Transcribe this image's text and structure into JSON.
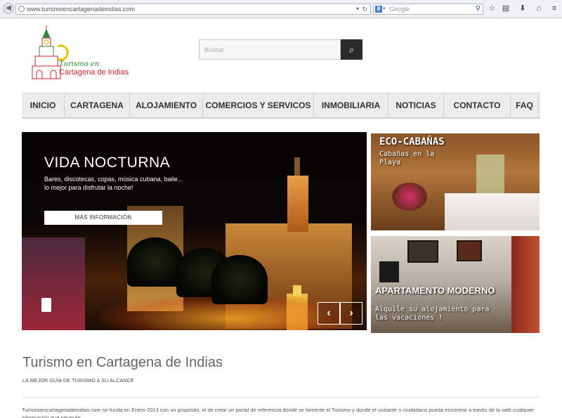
{
  "browser": {
    "url": "www.turismoencartagenadeindias.com",
    "search_placeholder": "Google"
  },
  "logo": {
    "line1": "Turismo en",
    "line2": "Cartagena de Indias"
  },
  "site_search": {
    "placeholder": "Buscar"
  },
  "nav": {
    "items": [
      "INICIO",
      "CARTAGENA",
      "ALOJAMIENTO",
      "COMERCIOS Y SERVICOS",
      "INMOBILIARIA",
      "NOTICIAS",
      "CONTACTO",
      "FAQ"
    ]
  },
  "hero": {
    "title": "VIDA NOCTURNA",
    "text": "Bares, discotecas, copas, música cubana, baile... lo mejor para disfrutar la noche!",
    "button": "MÁS INFORMACIÓN",
    "prev": "‹",
    "next": "›"
  },
  "cards": [
    {
      "title": "ECO-CABAÑAS",
      "subtitle": "Cabañas en la Playa"
    },
    {
      "title": "APARTAMENTO MODERNO",
      "subtitle": "Alquile su alojamiento para las vacaciones !"
    }
  ],
  "main": {
    "title": "Turismo en Cartagena de Indias",
    "tagline": "LA MEJOR GUÍA DE TURISMO A SU ALCANCE",
    "intro": "Turismoencartagenadeindias com se funda en Enero 2013 con un propósito, el de crear un portal de referencia donde se fomente el Turismo y donde el visitante o ciudadano pueda encontrar a través de la web cualquier información que necesite."
  }
}
